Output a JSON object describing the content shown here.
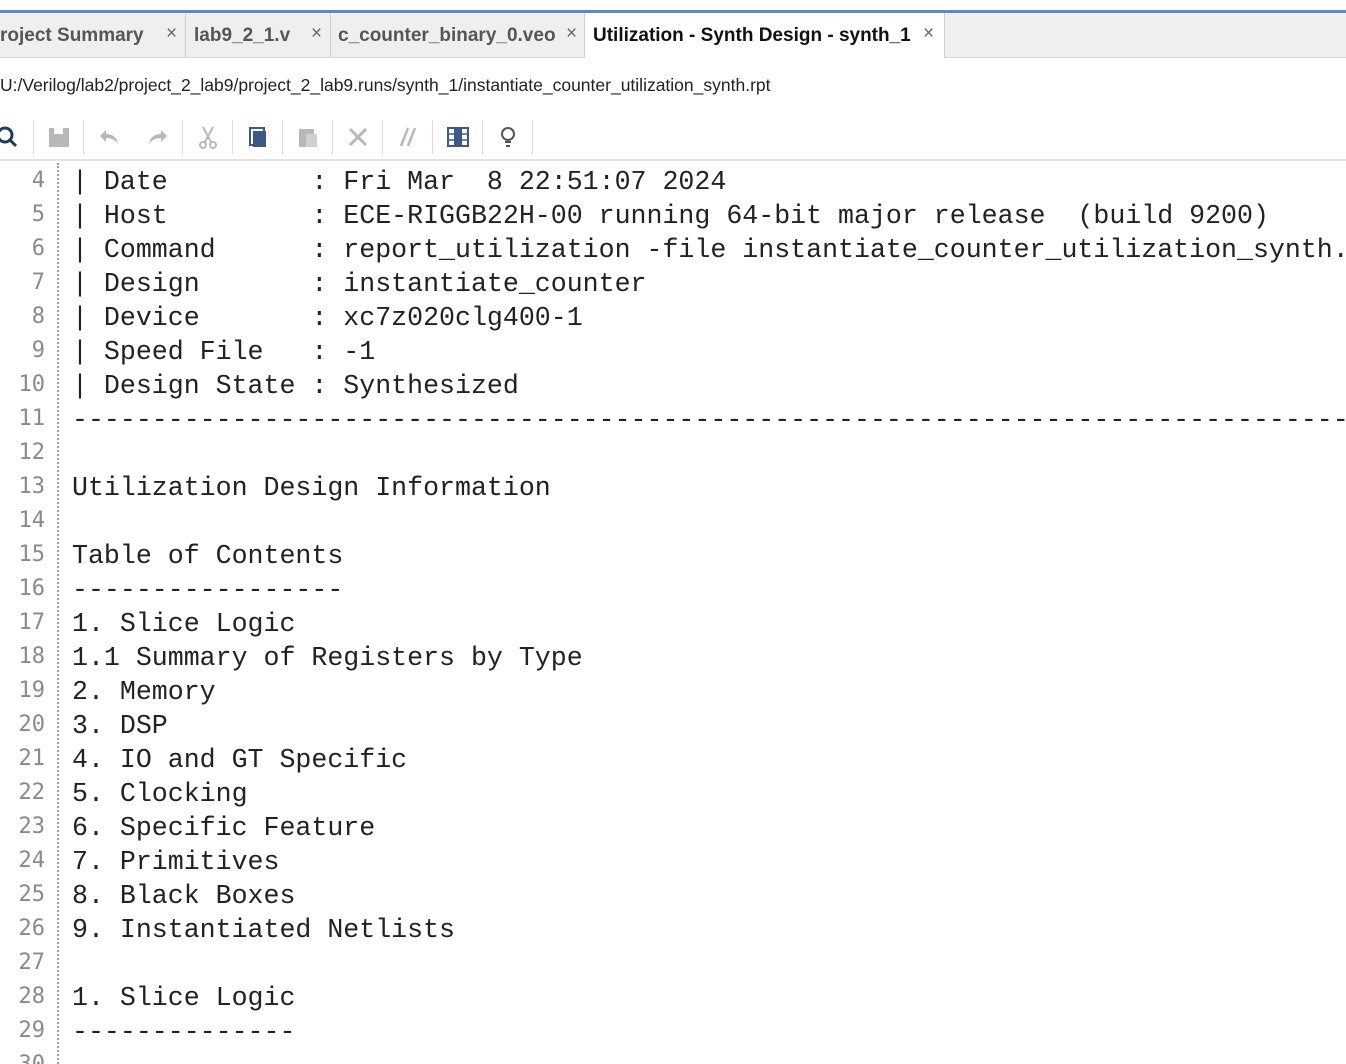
{
  "tabs": [
    {
      "label": "roject Summary",
      "active": false
    },
    {
      "label": "lab9_2_1.v",
      "active": false
    },
    {
      "label": "c_counter_binary_0.veo",
      "active": false
    },
    {
      "label": "Utilization - Synth Design - synth_1",
      "active": true
    }
  ],
  "tab_close_glyph": "×",
  "file_path": "U:/Verilog/lab2/project_2_lab9/project_2_lab9.runs/synth_1/instantiate_counter_utilization_synth.rpt",
  "toolbar_icons": [
    "search-icon",
    "save-icon",
    "undo-icon",
    "redo-icon",
    "cut-icon",
    "copy-icon",
    "paste-icon",
    "delete-icon",
    "comment-icon",
    "column-select-icon",
    "lightbulb-icon"
  ],
  "editor": {
    "lines": [
      {
        "num": "4",
        "text": "| Date         : Fri Mar  8 22:51:07 2024"
      },
      {
        "num": "5",
        "text": "| Host         : ECE-RIGGB22H-00 running 64-bit major release  (build 9200)"
      },
      {
        "num": "6",
        "text": "| Command      : report_utilization -file instantiate_counter_utilization_synth.rpt -pb instantiate_counter_utilization_synth.pb"
      },
      {
        "num": "7",
        "text": "| Design       : instantiate_counter"
      },
      {
        "num": "8",
        "text": "| Device       : xc7z020clg400-1"
      },
      {
        "num": "9",
        "text": "| Speed File   : -1"
      },
      {
        "num": "10",
        "text": "| Design State : Synthesized"
      },
      {
        "num": "11",
        "text": "--------------------------------------------------------------------------------------------------------------------------------"
      },
      {
        "num": "12",
        "text": ""
      },
      {
        "num": "13",
        "text": "Utilization Design Information"
      },
      {
        "num": "14",
        "text": ""
      },
      {
        "num": "15",
        "text": "Table of Contents"
      },
      {
        "num": "16",
        "text": "-----------------"
      },
      {
        "num": "17",
        "text": "1. Slice Logic"
      },
      {
        "num": "18",
        "text": "1.1 Summary of Registers by Type"
      },
      {
        "num": "19",
        "text": "2. Memory"
      },
      {
        "num": "20",
        "text": "3. DSP"
      },
      {
        "num": "21",
        "text": "4. IO and GT Specific"
      },
      {
        "num": "22",
        "text": "5. Clocking"
      },
      {
        "num": "23",
        "text": "6. Specific Feature"
      },
      {
        "num": "24",
        "text": "7. Primitives"
      },
      {
        "num": "25",
        "text": "8. Black Boxes"
      },
      {
        "num": "26",
        "text": "9. Instantiated Netlists"
      },
      {
        "num": "27",
        "text": ""
      },
      {
        "num": "28",
        "text": "1. Slice Logic"
      },
      {
        "num": "29",
        "text": "--------------"
      },
      {
        "num": "30",
        "text": ""
      }
    ]
  }
}
